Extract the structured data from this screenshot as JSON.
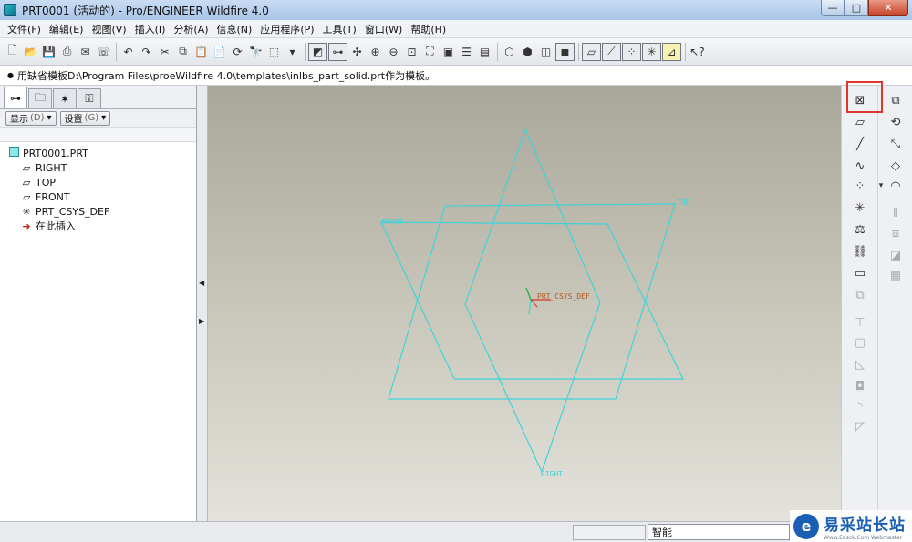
{
  "window": {
    "title": "PRT0001 (活动的) - Pro/ENGINEER Wildfire 4.0",
    "buttons": {
      "minimize": "—",
      "maximize": "□",
      "close": "✕"
    }
  },
  "menu": [
    "文件(F)",
    "编辑(E)",
    "视图(V)",
    "插入(I)",
    "分析(A)",
    "信息(N)",
    "应用程序(P)",
    "工具(T)",
    "窗口(W)",
    "帮助(H)"
  ],
  "message": "用缺省模板D:\\Program Files\\proeWildfire 4.0\\templates\\inlbs_part_solid.prt作为模板。",
  "left_panel": {
    "filter_buttons": [
      {
        "label": "显示",
        "hint": "(D)"
      },
      {
        "label": "设置",
        "hint": "(G)"
      }
    ],
    "tree": {
      "root": "PRT0001.PRT",
      "items": [
        {
          "label": "RIGHT",
          "icon": "datum-plane-icon"
        },
        {
          "label": "TOP",
          "icon": "datum-plane-icon"
        },
        {
          "label": "FRONT",
          "icon": "datum-plane-icon"
        },
        {
          "label": "PRT_CSYS_DEF",
          "icon": "coordinate-system-icon"
        },
        {
          "label": "在此插入",
          "icon": "insert-here-arrow-icon"
        }
      ]
    }
  },
  "graphics": {
    "labels": {
      "csys": "PRT_CSYS_DEF",
      "right": "RIGHT",
      "top": "TOP",
      "front": "FRONT"
    },
    "datum_color": "#3fd3d9"
  },
  "status": {
    "filter": "智能"
  },
  "watermark": {
    "logo": "e",
    "main": "易采站长站",
    "sub": "Www.Easck.Com Webmaster"
  }
}
